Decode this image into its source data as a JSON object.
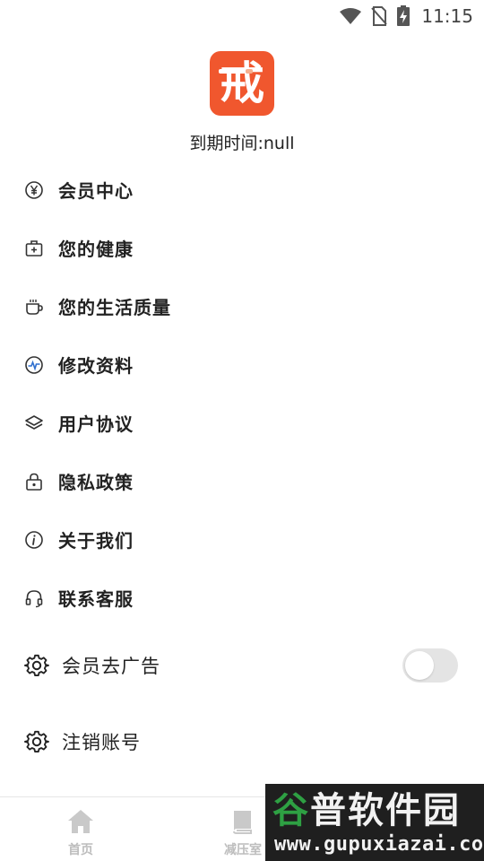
{
  "status_bar": {
    "time": "11:15",
    "icons": [
      "wifi-icon",
      "no-sim-icon",
      "battery-charging-icon"
    ]
  },
  "app": {
    "logo_char": "戒",
    "logo_color": "#f0572e",
    "expiry_text": "到期时间:null"
  },
  "menu": {
    "items": [
      {
        "label": "会员中心",
        "icon": "yen-circle-icon"
      },
      {
        "label": "您的健康",
        "icon": "medical-kit-icon"
      },
      {
        "label": "您的生活质量",
        "icon": "coffee-cup-icon"
      },
      {
        "label": "修改资料",
        "icon": "activity-pulse-icon"
      },
      {
        "label": "用户协议",
        "icon": "layers-icon"
      },
      {
        "label": "隐私政策",
        "icon": "lock-icon"
      },
      {
        "label": "关于我们",
        "icon": "info-icon"
      },
      {
        "label": "联系客服",
        "icon": "headset-icon"
      }
    ]
  },
  "settings": {
    "ad_free": {
      "label": "会员去广告",
      "icon": "gear-icon",
      "enabled": false
    },
    "cancel_account": {
      "label": "注销账号",
      "icon": "gear-icon"
    }
  },
  "bottom_nav": {
    "tabs": [
      {
        "label": "首页",
        "icon": "home-icon"
      },
      {
        "label": "减压室",
        "icon": "book-icon"
      }
    ]
  },
  "watermark": {
    "title_part1": "谷",
    "title_part2": "普软件园",
    "url": "www.gupuxiazai.com"
  }
}
